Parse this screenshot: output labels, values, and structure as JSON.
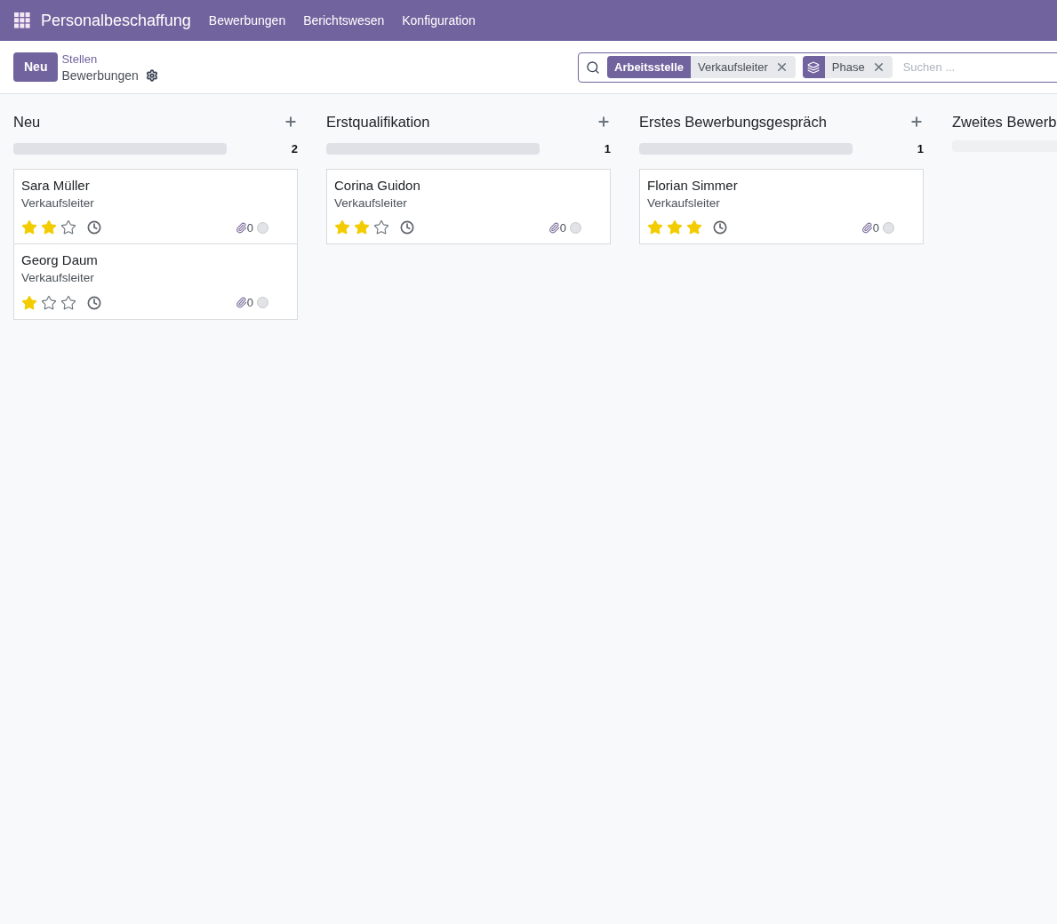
{
  "navbar": {
    "app_name": "Personalbeschaffung",
    "menu": [
      "Bewerbungen",
      "Berichtswesen",
      "Konfiguration"
    ]
  },
  "control_panel": {
    "new_button": "Neu",
    "breadcrumb": "Stellen",
    "current": "Bewerbungen"
  },
  "search": {
    "facets": [
      {
        "kind": "field",
        "label": "Arbeitsstelle",
        "value": "Verkaufsleiter"
      },
      {
        "kind": "group",
        "value": "Phase"
      }
    ],
    "placeholder": "Suchen ..."
  },
  "columns": [
    {
      "title": "Neu",
      "count": "2",
      "level": 0,
      "cards": [
        {
          "name": "Sara Müller",
          "job": "Verkaufsleiter",
          "stars": 2,
          "attachments": "0"
        },
        {
          "name": "Georg Daum",
          "job": "Verkaufsleiter",
          "stars": 1,
          "attachments": "0"
        }
      ]
    },
    {
      "title": "Erstqualifikation",
      "count": "1",
      "level": 0,
      "cards": [
        {
          "name": "Corina Guidon",
          "job": "Verkaufsleiter",
          "stars": 2,
          "attachments": "0"
        }
      ]
    },
    {
      "title": "Erstes Bewerbungsgespräch",
      "count": "1",
      "level": 0,
      "cards": [
        {
          "name": "Florian Simmer",
          "job": "Verkaufsleiter",
          "stars": 3,
          "attachments": "0"
        }
      ]
    },
    {
      "title": "Zweites Bewerb",
      "level": 0
    }
  ]
}
